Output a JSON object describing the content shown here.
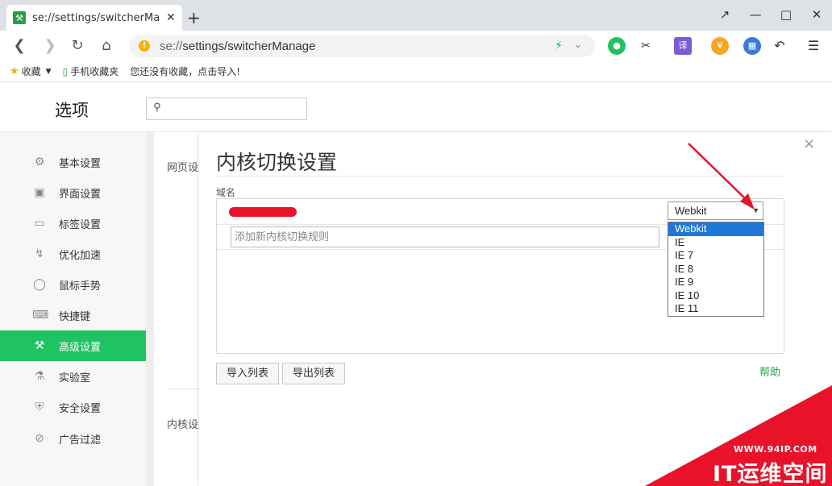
{
  "browser": {
    "tab_title": "se://settings/switcherManag",
    "new_tab": "+",
    "url_prefix": "se://",
    "url_path": "settings/switcherManage",
    "window_controls": [
      "↗",
      "—",
      "□",
      "✕"
    ]
  },
  "bookmarks": {
    "favorites": "收藏",
    "mobile": "手机收藏夹",
    "empty_hint": "您还没有收藏，点击导入!"
  },
  "settings": {
    "title": "选项",
    "search_placeholder": ""
  },
  "sidebar": {
    "items": [
      {
        "label": "基本设置",
        "icon": "gear-icon"
      },
      {
        "label": "界面设置",
        "icon": "window-icon"
      },
      {
        "label": "标签设置",
        "icon": "tab-icon"
      },
      {
        "label": "优化加速",
        "icon": "bolt-icon"
      },
      {
        "label": "鼠标手势",
        "icon": "mouse-icon"
      },
      {
        "label": "快捷键",
        "icon": "keyboard-icon"
      },
      {
        "label": "高级设置",
        "icon": "wrench-icon",
        "active": true
      },
      {
        "label": "实验室",
        "icon": "flask-icon"
      },
      {
        "label": "安全设置",
        "icon": "shield-icon"
      },
      {
        "label": "广告过滤",
        "icon": "block-icon"
      }
    ]
  },
  "background": {
    "section1": "网页设",
    "section2": "内核设"
  },
  "modal": {
    "title": "内核切换设置",
    "domain_label": "域名",
    "add_placeholder": "添加新内核切换规则",
    "selected_kernel": "Webkit",
    "kernel_options": [
      "Webkit",
      "IE",
      "IE 7",
      "IE 8",
      "IE 9",
      "IE 10",
      "IE 11"
    ],
    "import_label": "导入列表",
    "export_label": "导出列表",
    "help_label": "帮助",
    "close": "×"
  },
  "watermark": {
    "url": "WWW.94IP.COM",
    "text": "IT运维空间"
  },
  "colors": {
    "accent": "#21c262",
    "annotation": "#e8132a",
    "selection": "#1e78d7"
  }
}
